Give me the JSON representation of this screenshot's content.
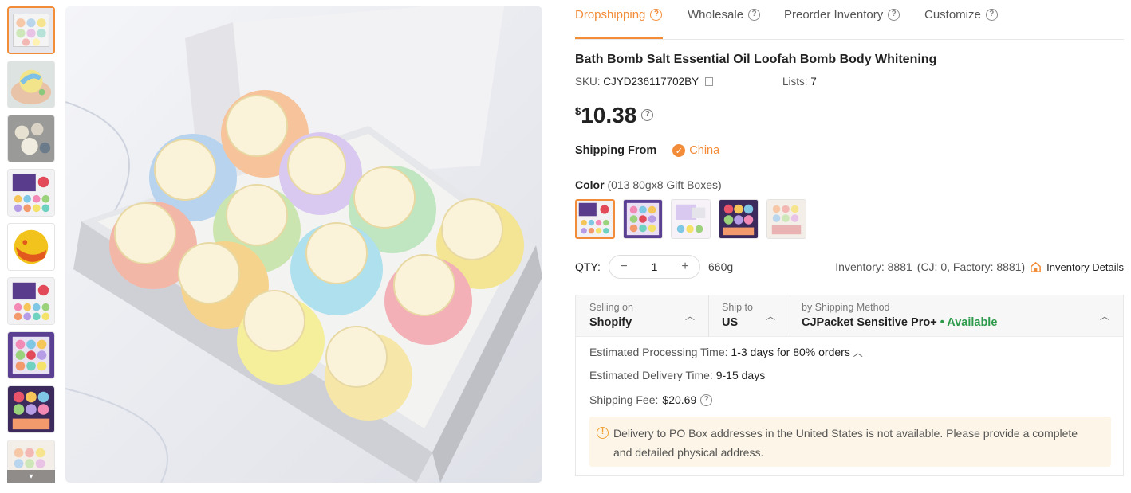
{
  "tabs": [
    {
      "label": "Dropshipping",
      "active": true
    },
    {
      "label": "Wholesale",
      "active": false
    },
    {
      "label": "Preorder Inventory",
      "active": false
    },
    {
      "label": "Customize",
      "active": false
    }
  ],
  "product": {
    "title": "Bath Bomb Salt Essential Oil Loofah Bomb Body Whitening",
    "sku_label": "SKU:",
    "sku": "CJYD236117702BY",
    "lists_label": "Lists:",
    "lists": "7",
    "currency": "$",
    "price": "10.38"
  },
  "shipping_from": {
    "label": "Shipping From",
    "country": "China"
  },
  "color": {
    "label": "Color",
    "selected": "(013 80gx8 Gift Boxes)",
    "swatch_count": 5,
    "selected_index": 0
  },
  "quantity": {
    "label": "QTY:",
    "value": "1",
    "minus": "−",
    "plus": "+",
    "weight": "660g",
    "inventory_text": "Inventory: 8881",
    "inventory_breakdown": "(CJ: 0, Factory: 8881)",
    "inventory_link": "Inventory Details"
  },
  "shipping": {
    "selling_on_label": "Selling on",
    "selling_on": "Shopify",
    "ship_to_label": "Ship to",
    "ship_to": "US",
    "method_label": "by Shipping Method",
    "method": "CJPacket Sensitive Pro+",
    "availability": "• Available",
    "processing_label": "Estimated Processing Time:",
    "processing": "1-3 days for 80% orders",
    "delivery_label": "Estimated Delivery Time:",
    "delivery": "9-15 days",
    "fee_label": "Shipping Fee:",
    "fee": "$20.69",
    "notice_line1": "Delivery to PO Box addresses in the United States is not available. Please provide a complete",
    "notice_line2": "and detailed physical address."
  },
  "colors": {
    "accent": "#f28c38",
    "available": "#2e9b4b",
    "notice_bg": "#fdf6e8"
  },
  "icons": [
    "help-circle-icon",
    "copy-icon",
    "check-circle-icon",
    "chevron-up-icon",
    "chevron-down-icon",
    "warehouse-icon",
    "warning-icon"
  ]
}
